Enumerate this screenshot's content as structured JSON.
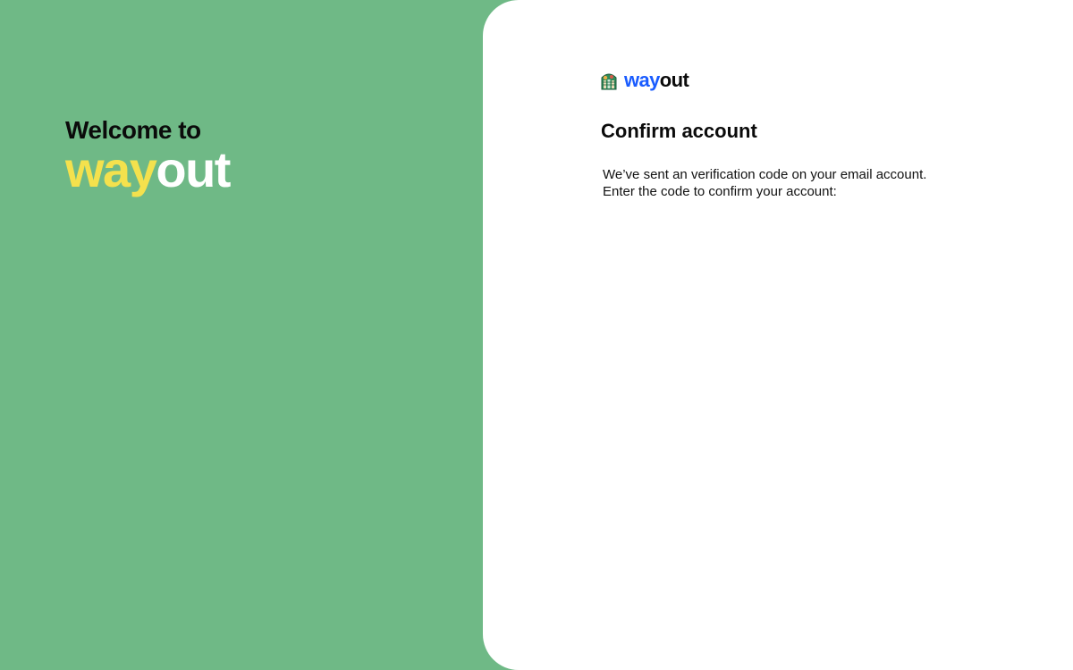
{
  "welcome": {
    "greeting": "Welcome to",
    "brand_way": "way",
    "brand_out": "out"
  },
  "logo": {
    "icon": "wayout-logo-icon",
    "brand_way": "way",
    "brand_out": "out"
  },
  "confirm": {
    "title": "Confirm account",
    "line1": "We’ve sent an verification code on your email account.",
    "line2": "Enter the code to confirm your account:"
  },
  "colors": {
    "left_background": "#6fb986",
    "brand_yellow": "#f4e14d",
    "brand_blue": "#1a5cff",
    "panel_background": "#ffffff"
  }
}
